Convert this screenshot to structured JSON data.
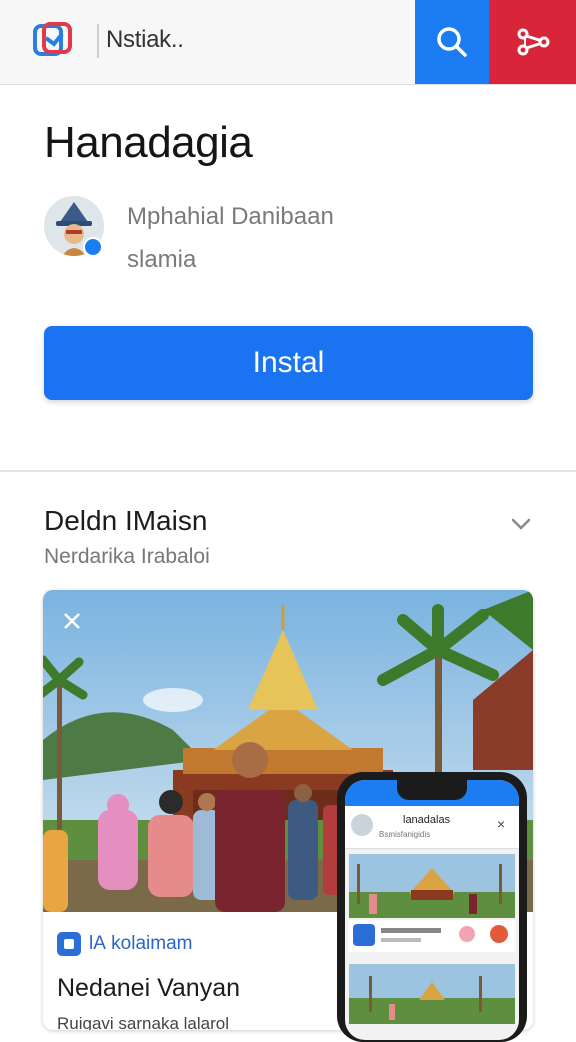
{
  "header": {
    "site_name": "Nstiak..",
    "search_label": "search",
    "share_label": "share",
    "colors": {
      "search": "#1c7cf2",
      "share": "#d9253a"
    }
  },
  "app": {
    "title": "Hanadagia",
    "developer_line1": "Mphahial Danibaan",
    "developer_line2": "slamia",
    "install_label": "Instal"
  },
  "section": {
    "title": "Deldn IMaisn",
    "subtitle": "Nerdarika Irabaloi"
  },
  "card": {
    "meta_text": "lА kolaimam",
    "title": "Nedanei Vanyan",
    "description": "Ruigavi sarnaka lalarol"
  },
  "phone": {
    "title": "lanadalas",
    "subtitle": "Bsmisfanigidis"
  },
  "icons": [
    "app-logo-icon",
    "search-icon",
    "share-icon",
    "verified-icon",
    "chevron-down-icon",
    "close-icon",
    "card-app-icon"
  ]
}
